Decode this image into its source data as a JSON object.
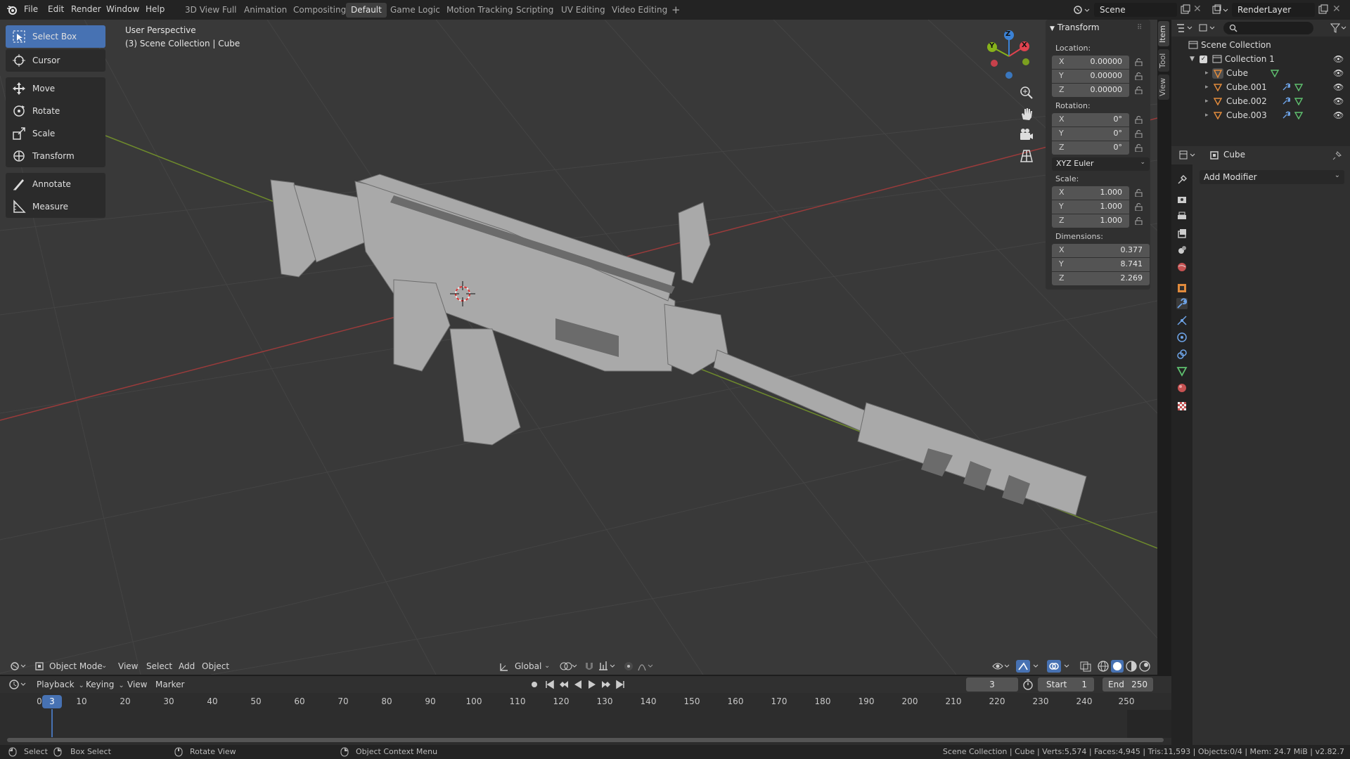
{
  "topbar": {
    "menus": [
      "File",
      "Edit",
      "Render",
      "Window",
      "Help"
    ],
    "workspaces": [
      "3D View Full",
      "Animation",
      "Compositing",
      "Default",
      "Game Logic",
      "Motion Tracking",
      "Scripting",
      "UV Editing",
      "Video Editing"
    ],
    "active_workspace": "Default",
    "add_tab": "+",
    "scene": "Scene",
    "render_layer": "RenderLayer"
  },
  "viewport": {
    "perspective": "User Perspective",
    "collection_path": "(3) Scene Collection | Cube",
    "gizmo": {
      "x": "X",
      "y": "Y",
      "z": "Z"
    }
  },
  "toolbar": {
    "tools": [
      {
        "label": "Select Box",
        "icon": "select-box-icon"
      },
      {
        "label": "Cursor",
        "icon": "cursor-icon"
      },
      {
        "label": "Move",
        "icon": "move-icon"
      },
      {
        "label": "Rotate",
        "icon": "rotate-icon"
      },
      {
        "label": "Scale",
        "icon": "scale-icon"
      },
      {
        "label": "Transform",
        "icon": "transform-icon"
      },
      {
        "label": "Annotate",
        "icon": "annotate-icon"
      },
      {
        "label": "Measure",
        "icon": "measure-icon"
      }
    ]
  },
  "npanel": {
    "title": "Transform",
    "location_label": "Location:",
    "location": {
      "x": "0.00000",
      "y": "0.00000",
      "z": "0.00000"
    },
    "rotation_label": "Rotation:",
    "rotation": {
      "x": "0°",
      "y": "0°",
      "z": "0°"
    },
    "rotation_mode": "XYZ Euler",
    "scale_label": "Scale:",
    "scale": {
      "x": "1.000",
      "y": "1.000",
      "z": "1.000"
    },
    "dimensions_label": "Dimensions:",
    "dimensions": {
      "x": "0.377",
      "y": "8.741",
      "z": "2.269"
    },
    "axis": {
      "x": "X",
      "y": "Y",
      "z": "Z"
    },
    "tabs": [
      "Item",
      "Tool",
      "View"
    ]
  },
  "outliner": {
    "root": "Scene Collection",
    "collection": "Collection 1",
    "objects": [
      "Cube",
      "Cube.001",
      "Cube.002",
      "Cube.003"
    ]
  },
  "properties": {
    "object_name": "Cube",
    "add_modifier": "Add Modifier"
  },
  "vp_header": {
    "mode": "Object Mode",
    "menus": [
      "View",
      "Select",
      "Add",
      "Object"
    ],
    "orientation": "Global"
  },
  "timeline": {
    "menus": [
      "Playback",
      "Keying",
      "View",
      "Marker"
    ],
    "current_frame": "3",
    "start_label": "Start",
    "start": "1",
    "end_label": "End",
    "end": "250",
    "ticks": [
      "0",
      "3",
      "10",
      "20",
      "30",
      "40",
      "50",
      "60",
      "70",
      "80",
      "90",
      "100",
      "110",
      "120",
      "130",
      "140",
      "150",
      "160",
      "170",
      "180",
      "190",
      "200",
      "210",
      "220",
      "230",
      "240",
      "250"
    ]
  },
  "statusbar": {
    "select": "Select",
    "box_select": "Box Select",
    "rotate_view": "Rotate View",
    "context_menu": "Object Context Menu",
    "stats": "Scene Collection | Cube | Verts:5,574 | Faces:4,945 | Tris:11,593 | Objects:0/4 | Mem: 24.7 MiB | v2.82.7"
  },
  "colors": {
    "accent": "#4772b3",
    "x_axis": "#e0434f",
    "y_axis": "#87b21b",
    "z_axis": "#3b82d6",
    "object_orange": "#e08a3c"
  }
}
